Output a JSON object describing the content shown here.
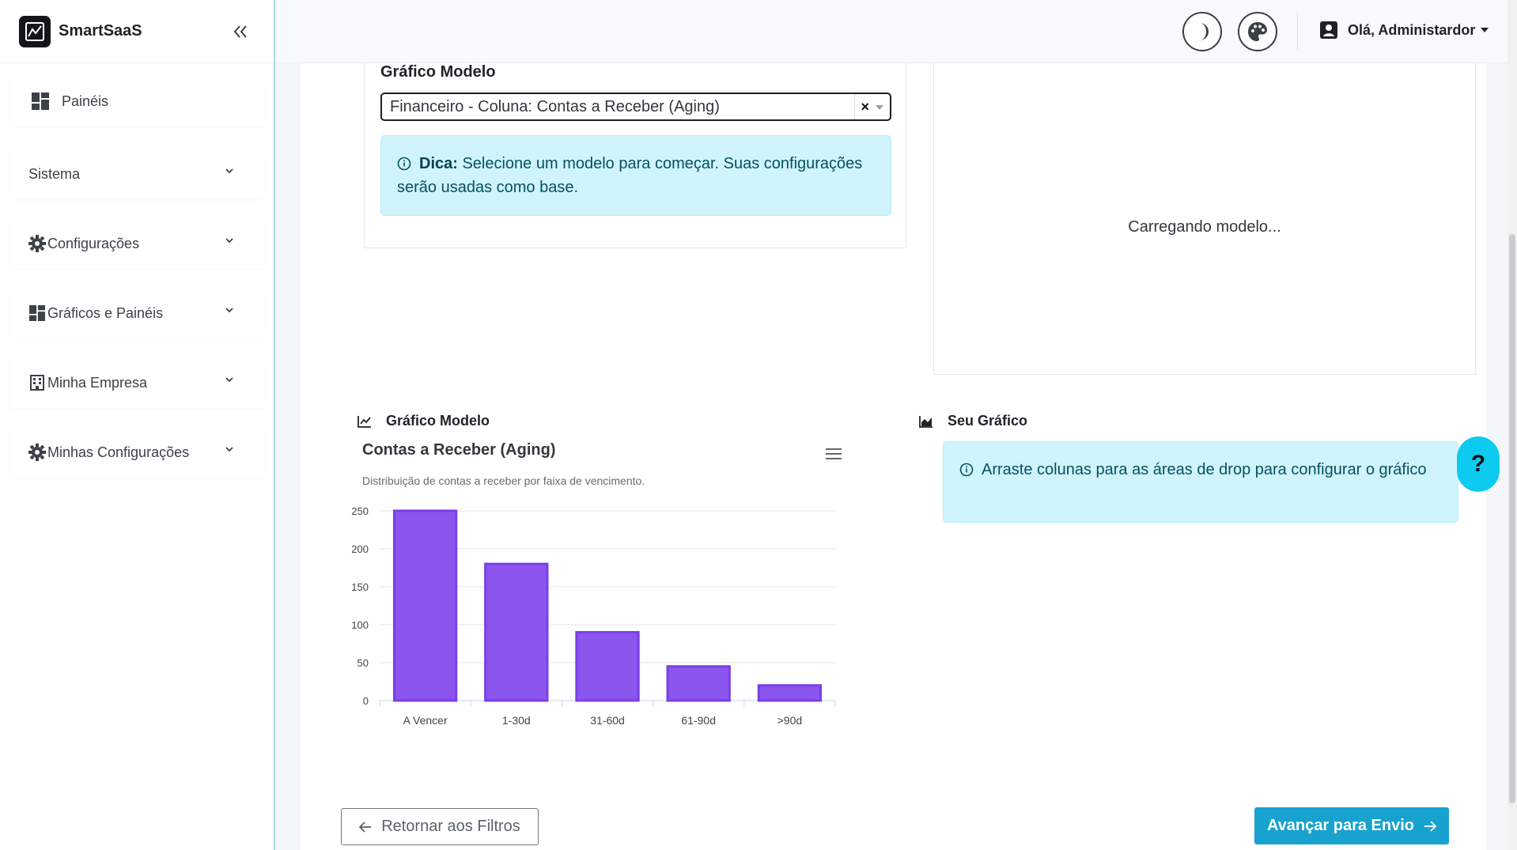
{
  "app": {
    "name": "SmartSaaS"
  },
  "sidebar": {
    "items": [
      {
        "label": "Painéis",
        "icon": "dashboard-icon"
      },
      {
        "label": "Sistema",
        "icon": ""
      },
      {
        "label": "Configurações",
        "icon": "gear-icon"
      },
      {
        "label": "Gráficos e Painéis",
        "icon": "dashboard-icon"
      },
      {
        "label": "Minha Empresa",
        "icon": "building-icon"
      },
      {
        "label": "Minhas Configurações",
        "icon": "gear-icon"
      }
    ]
  },
  "header": {
    "user_greeting": "Olá, Administardor"
  },
  "template_panel": {
    "title": "Gráfico Modelo",
    "selected_template": "Financeiro - Coluna: Contas a Receber (Aging)",
    "tip_bold": "Dica:",
    "tip_text": " Selecione um modelo para começar. Suas configurações serão usadas como base."
  },
  "preview_panel": {
    "loading_text": "Carregando modelo..."
  },
  "model_chart_section": {
    "title": "Gráfico Modelo"
  },
  "your_chart_section": {
    "title": "Seu Gráfico",
    "info_text": "Arraste colunas para as áreas de drop para configurar o gráfico"
  },
  "chart_data": {
    "type": "bar",
    "title": "Contas a Receber (Aging)",
    "subtitle": "Distribuição de contas a receber por faixa de vencimento.",
    "categories": [
      "A Vencer",
      "1-30d",
      "31-60d",
      "61-90d",
      ">90d"
    ],
    "values": [
      250,
      180,
      90,
      45,
      20
    ],
    "ylim": [
      0,
      250
    ],
    "yticks": [
      0,
      50,
      100,
      150,
      200,
      250
    ],
    "color": "#8b55ee",
    "border_color": "#7a3fe6",
    "grid": true,
    "legend": false
  },
  "footer": {
    "back_label": "Retornar aos Filtros",
    "next_label": "Avançar para Envio"
  },
  "help": {
    "label": "?"
  },
  "colors": {
    "accent": "#17a2cf",
    "info_bg": "#cff4fc",
    "help_bg": "#0dcaf0"
  }
}
